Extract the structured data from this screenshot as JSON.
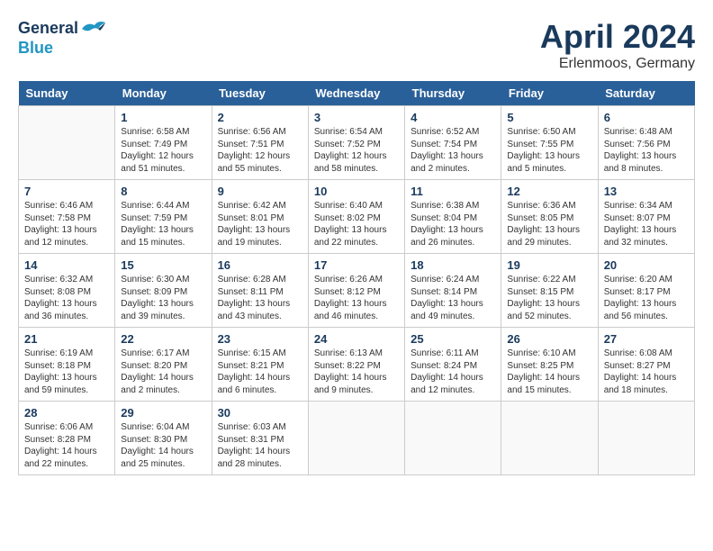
{
  "header": {
    "logo_line1": "General",
    "logo_line2": "Blue",
    "month_title": "April 2024",
    "subtitle": "Erlenmoos, Germany"
  },
  "days_of_week": [
    "Sunday",
    "Monday",
    "Tuesday",
    "Wednesday",
    "Thursday",
    "Friday",
    "Saturday"
  ],
  "weeks": [
    [
      {
        "day": "",
        "info": ""
      },
      {
        "day": "1",
        "info": "Sunrise: 6:58 AM\nSunset: 7:49 PM\nDaylight: 12 hours\nand 51 minutes."
      },
      {
        "day": "2",
        "info": "Sunrise: 6:56 AM\nSunset: 7:51 PM\nDaylight: 12 hours\nand 55 minutes."
      },
      {
        "day": "3",
        "info": "Sunrise: 6:54 AM\nSunset: 7:52 PM\nDaylight: 12 hours\nand 58 minutes."
      },
      {
        "day": "4",
        "info": "Sunrise: 6:52 AM\nSunset: 7:54 PM\nDaylight: 13 hours\nand 2 minutes."
      },
      {
        "day": "5",
        "info": "Sunrise: 6:50 AM\nSunset: 7:55 PM\nDaylight: 13 hours\nand 5 minutes."
      },
      {
        "day": "6",
        "info": "Sunrise: 6:48 AM\nSunset: 7:56 PM\nDaylight: 13 hours\nand 8 minutes."
      }
    ],
    [
      {
        "day": "7",
        "info": "Sunrise: 6:46 AM\nSunset: 7:58 PM\nDaylight: 13 hours\nand 12 minutes."
      },
      {
        "day": "8",
        "info": "Sunrise: 6:44 AM\nSunset: 7:59 PM\nDaylight: 13 hours\nand 15 minutes."
      },
      {
        "day": "9",
        "info": "Sunrise: 6:42 AM\nSunset: 8:01 PM\nDaylight: 13 hours\nand 19 minutes."
      },
      {
        "day": "10",
        "info": "Sunrise: 6:40 AM\nSunset: 8:02 PM\nDaylight: 13 hours\nand 22 minutes."
      },
      {
        "day": "11",
        "info": "Sunrise: 6:38 AM\nSunset: 8:04 PM\nDaylight: 13 hours\nand 26 minutes."
      },
      {
        "day": "12",
        "info": "Sunrise: 6:36 AM\nSunset: 8:05 PM\nDaylight: 13 hours\nand 29 minutes."
      },
      {
        "day": "13",
        "info": "Sunrise: 6:34 AM\nSunset: 8:07 PM\nDaylight: 13 hours\nand 32 minutes."
      }
    ],
    [
      {
        "day": "14",
        "info": "Sunrise: 6:32 AM\nSunset: 8:08 PM\nDaylight: 13 hours\nand 36 minutes."
      },
      {
        "day": "15",
        "info": "Sunrise: 6:30 AM\nSunset: 8:09 PM\nDaylight: 13 hours\nand 39 minutes."
      },
      {
        "day": "16",
        "info": "Sunrise: 6:28 AM\nSunset: 8:11 PM\nDaylight: 13 hours\nand 43 minutes."
      },
      {
        "day": "17",
        "info": "Sunrise: 6:26 AM\nSunset: 8:12 PM\nDaylight: 13 hours\nand 46 minutes."
      },
      {
        "day": "18",
        "info": "Sunrise: 6:24 AM\nSunset: 8:14 PM\nDaylight: 13 hours\nand 49 minutes."
      },
      {
        "day": "19",
        "info": "Sunrise: 6:22 AM\nSunset: 8:15 PM\nDaylight: 13 hours\nand 52 minutes."
      },
      {
        "day": "20",
        "info": "Sunrise: 6:20 AM\nSunset: 8:17 PM\nDaylight: 13 hours\nand 56 minutes."
      }
    ],
    [
      {
        "day": "21",
        "info": "Sunrise: 6:19 AM\nSunset: 8:18 PM\nDaylight: 13 hours\nand 59 minutes."
      },
      {
        "day": "22",
        "info": "Sunrise: 6:17 AM\nSunset: 8:20 PM\nDaylight: 14 hours\nand 2 minutes."
      },
      {
        "day": "23",
        "info": "Sunrise: 6:15 AM\nSunset: 8:21 PM\nDaylight: 14 hours\nand 6 minutes."
      },
      {
        "day": "24",
        "info": "Sunrise: 6:13 AM\nSunset: 8:22 PM\nDaylight: 14 hours\nand 9 minutes."
      },
      {
        "day": "25",
        "info": "Sunrise: 6:11 AM\nSunset: 8:24 PM\nDaylight: 14 hours\nand 12 minutes."
      },
      {
        "day": "26",
        "info": "Sunrise: 6:10 AM\nSunset: 8:25 PM\nDaylight: 14 hours\nand 15 minutes."
      },
      {
        "day": "27",
        "info": "Sunrise: 6:08 AM\nSunset: 8:27 PM\nDaylight: 14 hours\nand 18 minutes."
      }
    ],
    [
      {
        "day": "28",
        "info": "Sunrise: 6:06 AM\nSunset: 8:28 PM\nDaylight: 14 hours\nand 22 minutes."
      },
      {
        "day": "29",
        "info": "Sunrise: 6:04 AM\nSunset: 8:30 PM\nDaylight: 14 hours\nand 25 minutes."
      },
      {
        "day": "30",
        "info": "Sunrise: 6:03 AM\nSunset: 8:31 PM\nDaylight: 14 hours\nand 28 minutes."
      },
      {
        "day": "",
        "info": ""
      },
      {
        "day": "",
        "info": ""
      },
      {
        "day": "",
        "info": ""
      },
      {
        "day": "",
        "info": ""
      }
    ]
  ]
}
